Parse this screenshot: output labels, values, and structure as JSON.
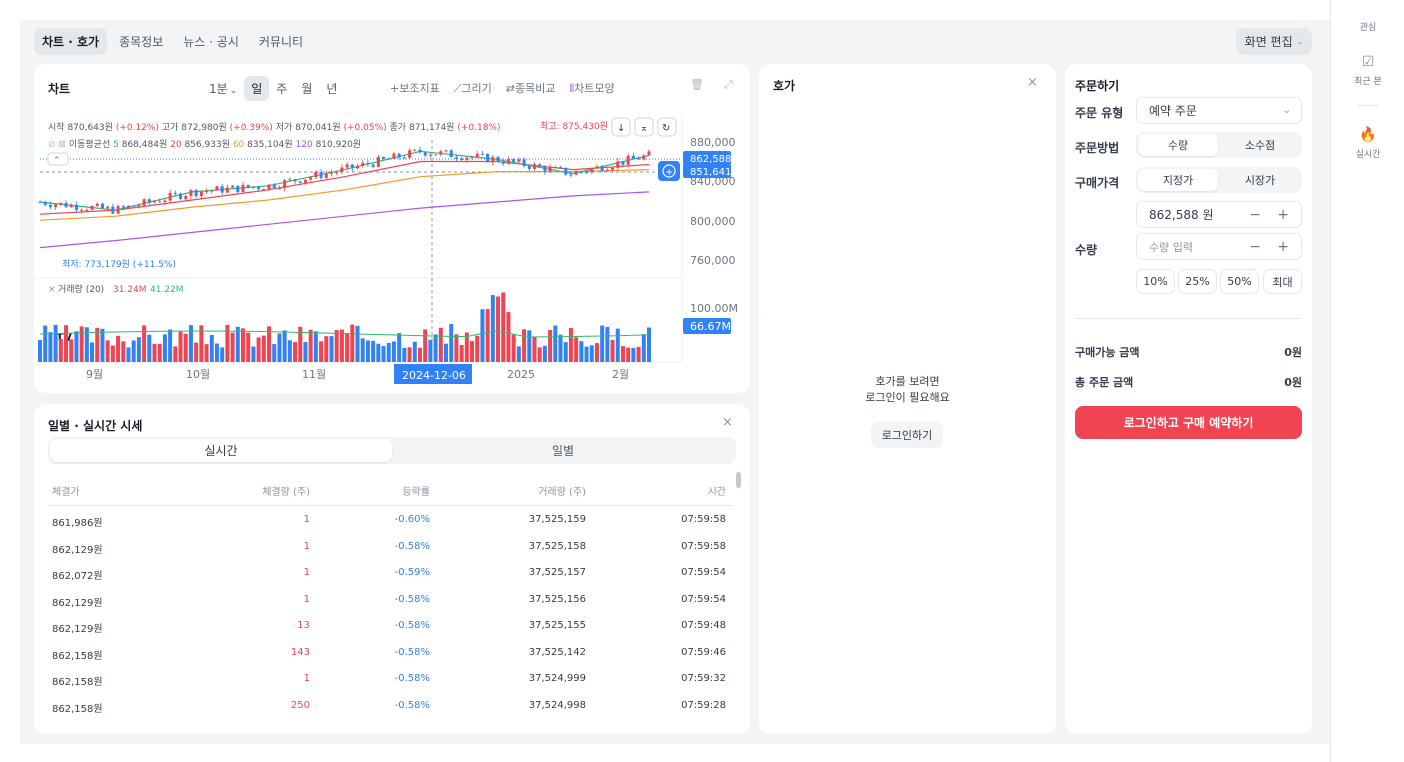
{
  "nav": {
    "tabs": [
      "차트 · 호가",
      "종목정보",
      "뉴스 · 공시",
      "커뮤니티"
    ],
    "edit_label": "화면 편집"
  },
  "chart": {
    "title": "차트",
    "timeframes": [
      "1분",
      "일",
      "주",
      "월",
      "년"
    ],
    "tools": [
      "보조지표",
      "그리기",
      "종목비교",
      "차트모양"
    ],
    "ohlc": {
      "open_label": "시작",
      "open": "870,643원",
      "open_chg": "(+0.12%)",
      "high_label": "고가",
      "high": "872,980원",
      "high_chg": "(+0.39%)",
      "low_label": "저가",
      "low": "870,041원",
      "low_chg": "(+0.05%)",
      "close_label": "종가",
      "close": "871,174원",
      "close_chg": "(+0.18%)"
    },
    "ma_label": "이동평균선",
    "ma": [
      {
        "period": "5",
        "value": "868,484원",
        "color": "#2fb96c"
      },
      {
        "period": "20",
        "value": "856,933원",
        "color": "#f04452"
      },
      {
        "period": "60",
        "value": "835,104원",
        "color": "#f59a23"
      },
      {
        "period": "120",
        "value": "810,920원",
        "color": "#a855f7"
      }
    ],
    "max_label": "최고: 875,430원",
    "min_label": "최저: 773,179원 (+11.5%)",
    "price_ticks": [
      "880,000",
      "840,000",
      "800,000",
      "760,000"
    ],
    "current_price": "862,588",
    "crosshair_price": "851,641",
    "volume_label": "거래량 (20)",
    "volume_v1": "31.24M",
    "volume_v2": "41.22M",
    "volume_ticks": [
      "100.00M"
    ],
    "volume_current": "66.67M",
    "x_ticks": [
      "9월",
      "10월",
      "11월",
      "2025",
      "2월"
    ],
    "crosshair_date": "2024-12-06",
    "logo": "TV"
  },
  "chart_data": {
    "type": "line",
    "title": "",
    "xlabel": "",
    "ylabel": "",
    "ylim": [
      745000,
      895000
    ],
    "x": [
      "9월",
      "10월",
      "11월",
      "2025",
      "2월"
    ],
    "series": [
      {
        "name": "5",
        "values": [
          820000,
          812000,
          830000,
          836000,
          852000,
          870000,
          862000,
          848000,
          866000
        ]
      },
      {
        "name": "20",
        "values": [
          808000,
          812000,
          822000,
          832000,
          845000,
          860000,
          860000,
          852000,
          857000
        ]
      },
      {
        "name": "60",
        "values": [
          802000,
          806000,
          815000,
          822000,
          832000,
          845000,
          850000,
          850000,
          852000
        ]
      },
      {
        "name": "120",
        "values": [
          775000,
          782000,
          790000,
          798000,
          806000,
          814000,
          820000,
          826000,
          830000
        ]
      }
    ]
  },
  "quotes": {
    "title": "일별 · 실시간 시세",
    "tabs": [
      "실시간",
      "일별"
    ],
    "columns": [
      "체결가",
      "체결량 (주)",
      "등락률",
      "거래량 (주)",
      "시간"
    ],
    "rows": [
      {
        "price": "861,986원",
        "qty": "1",
        "qty_side": "buy",
        "chg": "-0.60%",
        "vol": "37,525,159",
        "time": "07:59:58"
      },
      {
        "price": "862,129원",
        "qty": "1",
        "qty_side": "sell",
        "chg": "-0.58%",
        "vol": "37,525,158",
        "time": "07:59:58"
      },
      {
        "price": "862,072원",
        "qty": "1",
        "qty_side": "sell",
        "chg": "-0.59%",
        "vol": "37,525,157",
        "time": "07:59:54"
      },
      {
        "price": "862,129원",
        "qty": "1",
        "qty_side": "sell",
        "chg": "-0.58%",
        "vol": "37,525,156",
        "time": "07:59:54"
      },
      {
        "price": "862,129원",
        "qty": "13",
        "qty_side": "sell",
        "chg": "-0.58%",
        "vol": "37,525,155",
        "time": "07:59:48"
      },
      {
        "price": "862,158원",
        "qty": "143",
        "qty_side": "sell",
        "chg": "-0.58%",
        "vol": "37,525,142",
        "time": "07:59:46"
      },
      {
        "price": "862,158원",
        "qty": "1",
        "qty_side": "sell",
        "chg": "-0.58%",
        "vol": "37,524,999",
        "time": "07:59:32"
      },
      {
        "price": "862,158원",
        "qty": "250",
        "qty_side": "sell",
        "chg": "-0.58%",
        "vol": "37,524,998",
        "time": "07:59:28"
      }
    ]
  },
  "hoga": {
    "title": "호가",
    "message_line1": "호가를 보려면",
    "message_line2": "로그인이 필요해요",
    "login_label": "로그인하기"
  },
  "order": {
    "title": "주문하기",
    "type_label": "주문 유형",
    "type_value": "예약 주문",
    "method_label": "주문방법",
    "method_options": [
      "수량",
      "소수점"
    ],
    "price_label": "구매가격",
    "price_options": [
      "지정가",
      "시장가"
    ],
    "price_value": "862,588 원",
    "qty_label": "수량",
    "qty_placeholder": "수량 입력",
    "pct_options": [
      "10%",
      "25%",
      "50%",
      "최대"
    ],
    "avail_label": "구매가능 금액",
    "avail_value": "0원",
    "total_label": "총 주문 금액",
    "total_value": "0원",
    "submit_label": "로그인하고 구매 예약하기"
  },
  "rail": {
    "items": [
      "관심",
      "최근 본",
      "실시간"
    ]
  }
}
